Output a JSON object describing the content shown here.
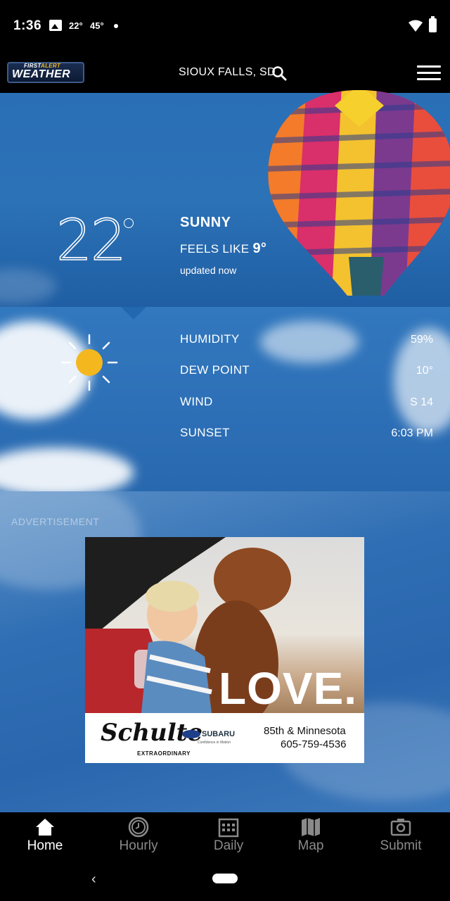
{
  "status_bar": {
    "time": "1:36",
    "temp1": "22°",
    "temp2": "45°"
  },
  "header": {
    "logo_top": "FIRST",
    "logo_top_accent": "ALERT",
    "logo_main": "WEATHER",
    "location": "SIOUX FALLS, SD"
  },
  "current": {
    "temperature": "22",
    "condition": "SUNNY",
    "feels_like_label": "FEELS LIKE",
    "feels_like_value": "9°",
    "updated": "updated now"
  },
  "details": [
    {
      "label": "HUMIDITY",
      "value": "59%"
    },
    {
      "label": "DEW POINT",
      "value": "10°"
    },
    {
      "label": "WIND",
      "value": "S 14"
    },
    {
      "label": "SUNSET",
      "value": "6:03 PM"
    }
  ],
  "ad": {
    "label": "ADVERTISEMENT",
    "headline": "LOVE.",
    "brand": "Schulte",
    "brand_sub": "EXTRAORDINARY",
    "partner": "SUBARU",
    "partner_tag": "Confidence in Motion",
    "address": "85th & Minnesota",
    "phone": "605-759-4536"
  },
  "nav": {
    "items": [
      {
        "label": "Home",
        "icon": "home-icon",
        "active": true
      },
      {
        "label": "Hourly",
        "icon": "clock-icon",
        "active": false
      },
      {
        "label": "Daily",
        "icon": "calendar-icon",
        "active": false
      },
      {
        "label": "Map",
        "icon": "map-icon",
        "active": false
      },
      {
        "label": "Submit",
        "icon": "camera-icon",
        "active": false
      }
    ]
  },
  "colors": {
    "sky_blue": "#2c72b7",
    "sun_yellow": "#f4b81e",
    "logo_accent": "#f2b71d"
  }
}
